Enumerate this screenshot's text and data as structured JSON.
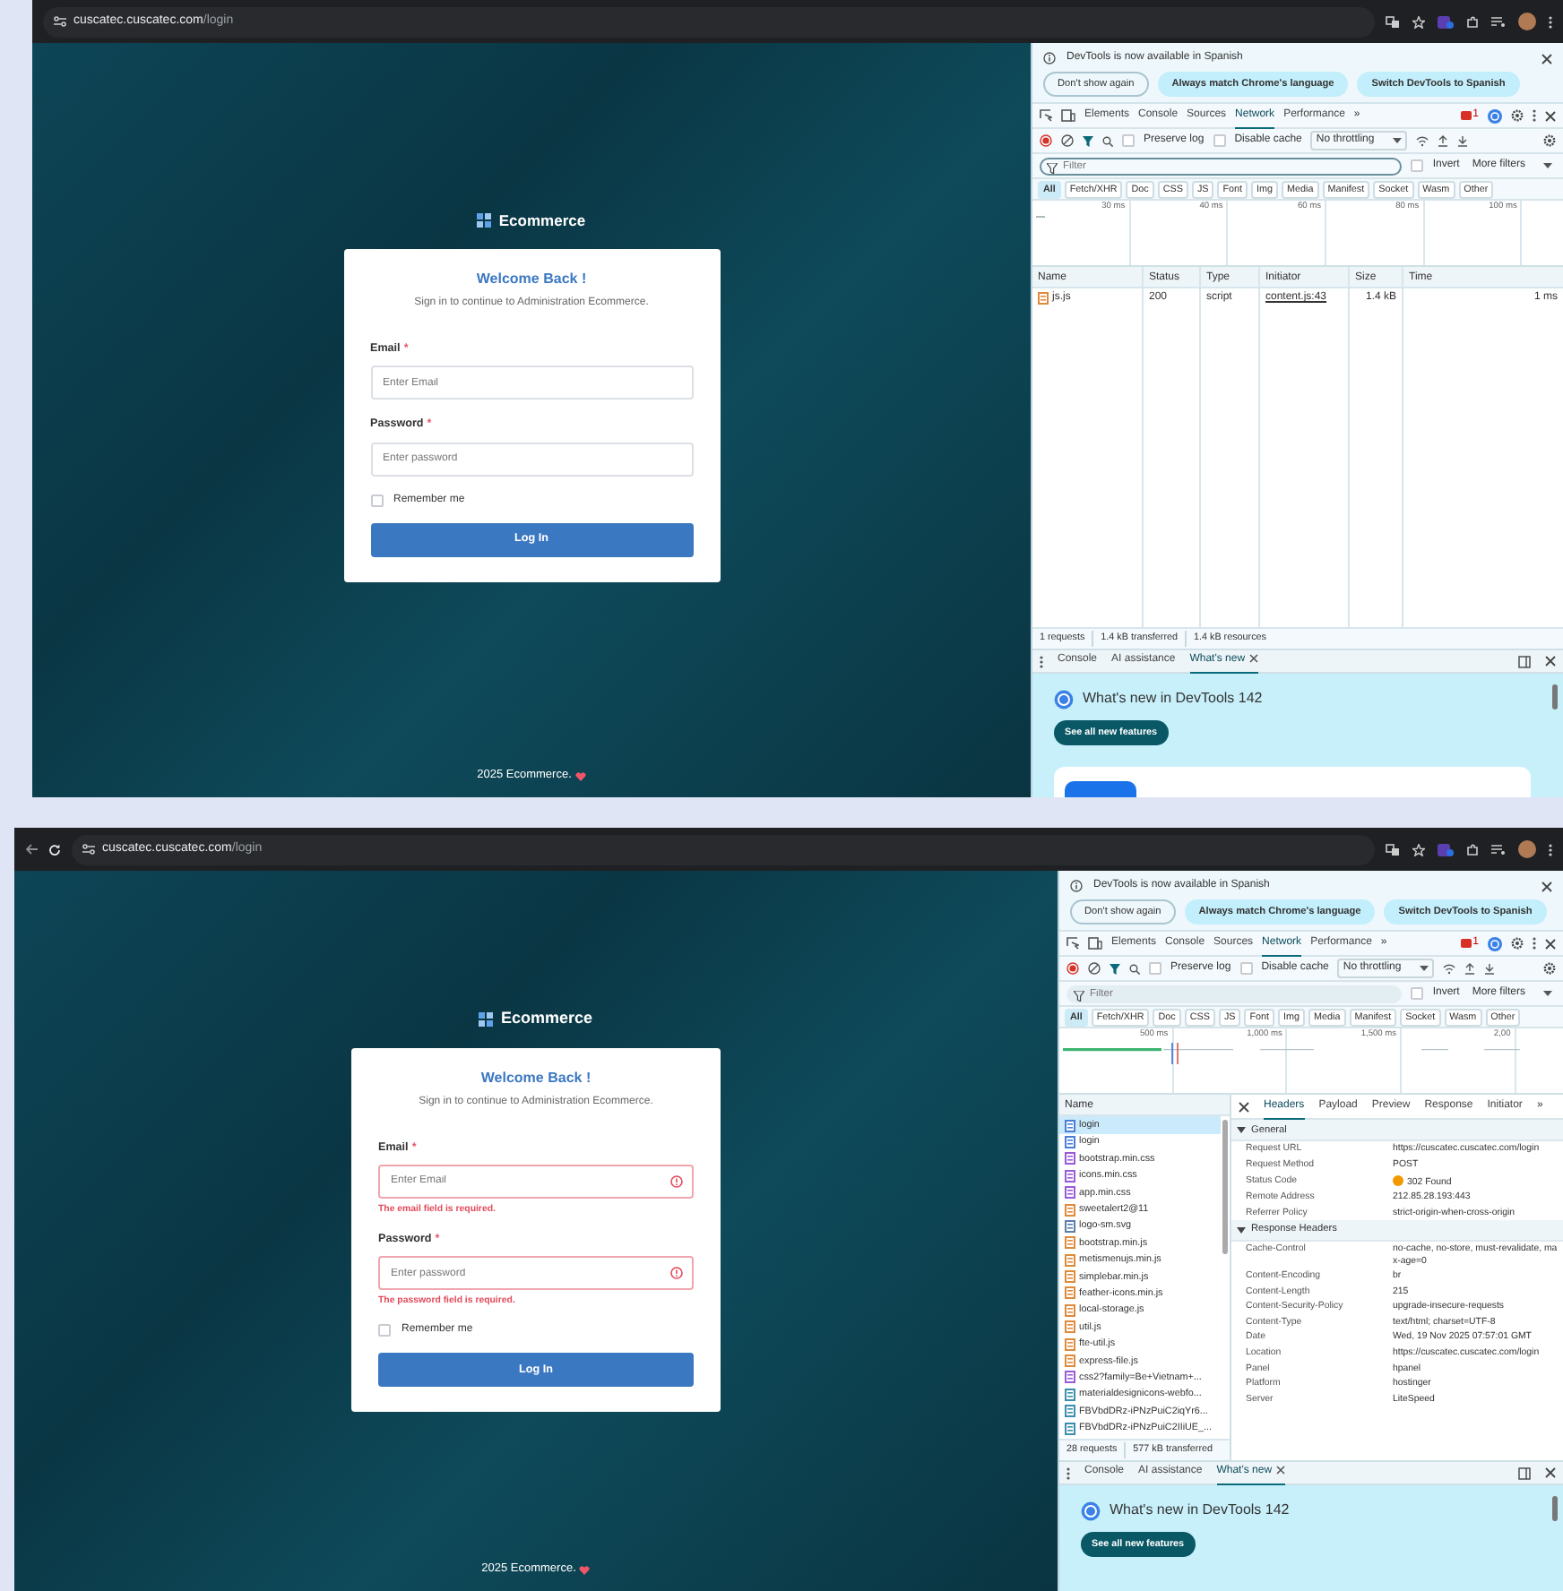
{
  "screens": [
    {
      "kind": "list",
      "address_bar": {
        "nav_buttons": false,
        "host": "cuscatec.cuscatec.com",
        "path": "/login"
      },
      "page": {
        "brand": "Ecommerce",
        "title": "Welcome Back !",
        "subtitle": "Sign in to continue to Administration Ecommerce.",
        "fields": [
          {
            "label": "Email",
            "required_mark": "*",
            "placeholder": "Enter Email",
            "invalid": false
          },
          {
            "label": "Password",
            "required_mark": "*",
            "placeholder": "Enter password",
            "invalid": false
          }
        ],
        "remember": {
          "label": "Remember me",
          "checked": false
        },
        "button": "Log In",
        "footer": "2025 Ecommerce."
      },
      "devtools": {
        "infobar": {
          "message": "DevTools is now available in Spanish",
          "buttons": [
            {
              "label": "Don't show again",
              "kind": "outline"
            },
            {
              "label": "Always match Chrome's language",
              "kind": "filled"
            },
            {
              "label": "Switch DevTools to Spanish",
              "kind": "filled"
            }
          ]
        },
        "tabs": [
          {
            "label": "Elements",
            "selected": false
          },
          {
            "label": "Console",
            "selected": false
          },
          {
            "label": "Sources",
            "selected": false
          },
          {
            "label": "Network",
            "selected": true
          },
          {
            "label": "Performance",
            "selected": false
          }
        ],
        "more_tabs": "»",
        "error_count": "1",
        "toolbar": {
          "preserve_log": {
            "label": "Preserve log",
            "checked": false
          },
          "disable_cache": {
            "label": "Disable cache",
            "checked": false
          },
          "throttling": "No throttling"
        },
        "filter": {
          "placeholder": "Filter",
          "invert": {
            "label": "Invert",
            "checked": false
          },
          "more_filters": "More filters"
        },
        "type_filters": [
          {
            "label": "All",
            "selected": true
          },
          {
            "label": "Fetch/XHR",
            "selected": false
          },
          {
            "label": "Doc",
            "selected": false
          },
          {
            "label": "CSS",
            "selected": false
          },
          {
            "label": "JS",
            "selected": false
          },
          {
            "label": "Font",
            "selected": false
          },
          {
            "label": "Img",
            "selected": false
          },
          {
            "label": "Media",
            "selected": false
          },
          {
            "label": "Manifest",
            "selected": false
          },
          {
            "label": "Socket",
            "selected": false
          },
          {
            "label": "Wasm",
            "selected": false
          },
          {
            "label": "Other",
            "selected": false
          }
        ],
        "overview_ticks": [
          "30 ms",
          "40 ms",
          "60 ms",
          "80 ms",
          "100 ms"
        ],
        "table": {
          "columns": [
            "Name",
            "Status",
            "Type",
            "Initiator",
            "Size",
            "Time"
          ],
          "rows": [
            {
              "kind": "js",
              "cells": [
                "js.js",
                "200",
                "script",
                "content.js:43",
                "1.4 kB",
                "1 ms"
              ]
            }
          ]
        },
        "summary": [
          "1 requests",
          "1.4 kB transferred",
          "1.4 kB resources"
        ],
        "drawer": {
          "tabs": [
            {
              "label": "Console",
              "selected": false,
              "closable": false
            },
            {
              "label": "AI assistance",
              "selected": false,
              "closable": false
            },
            {
              "label": "What's new",
              "selected": true,
              "closable": true
            }
          ],
          "heading": "What's new in DevTools 142",
          "button": "See all new features",
          "preview": true
        }
      }
    },
    {
      "kind": "details",
      "address_bar": {
        "nav_buttons": true,
        "host": "cuscatec.cuscatec.com",
        "path": "/login"
      },
      "page": {
        "brand": "Ecommerce",
        "title": "Welcome Back !",
        "subtitle": "Sign in to continue to Administration Ecommerce.",
        "fields": [
          {
            "label": "Email",
            "required_mark": "*",
            "placeholder": "Enter Email",
            "invalid": true,
            "error": "The email field is required."
          },
          {
            "label": "Password",
            "required_mark": "*",
            "placeholder": "Enter password",
            "invalid": true,
            "error": "The password field is required."
          }
        ],
        "remember": {
          "label": "Remember me",
          "checked": false
        },
        "button": "Log In",
        "footer": "2025 Ecommerce."
      },
      "devtools": {
        "infobar": {
          "message": "DevTools is now available in Spanish",
          "buttons": [
            {
              "label": "Don't show again",
              "kind": "outline"
            },
            {
              "label": "Always match Chrome's language",
              "kind": "filled"
            },
            {
              "label": "Switch DevTools to Spanish",
              "kind": "filled"
            }
          ]
        },
        "tabs": [
          {
            "label": "Elements",
            "selected": false
          },
          {
            "label": "Console",
            "selected": false
          },
          {
            "label": "Sources",
            "selected": false
          },
          {
            "label": "Network",
            "selected": true
          },
          {
            "label": "Performance",
            "selected": false
          }
        ],
        "more_tabs": "»",
        "error_count": "1",
        "toolbar": {
          "preserve_log": {
            "label": "Preserve log",
            "checked": false
          },
          "disable_cache": {
            "label": "Disable cache",
            "checked": false
          },
          "throttling": "No throttling"
        },
        "filter": {
          "placeholder": "Filter",
          "invert": {
            "label": "Invert",
            "checked": false
          },
          "more_filters": "More filters"
        },
        "type_filters": [
          {
            "label": "All",
            "selected": true
          },
          {
            "label": "Fetch/XHR",
            "selected": false
          },
          {
            "label": "Doc",
            "selected": false
          },
          {
            "label": "CSS",
            "selected": false
          },
          {
            "label": "JS",
            "selected": false
          },
          {
            "label": "Font",
            "selected": false
          },
          {
            "label": "Img",
            "selected": false
          },
          {
            "label": "Media",
            "selected": false
          },
          {
            "label": "Manifest",
            "selected": false
          },
          {
            "label": "Socket",
            "selected": false
          },
          {
            "label": "Wasm",
            "selected": false
          },
          {
            "label": "Other",
            "selected": false
          }
        ],
        "overview_ticks": [
          "500 ms",
          "1,000 ms",
          "1,500 ms",
          "2,00"
        ],
        "requests_header": "Name",
        "requests": [
          {
            "name": "login",
            "kind": "doc",
            "selected": true
          },
          {
            "name": "login",
            "kind": "doc",
            "selected": false
          },
          {
            "name": "bootstrap.min.css",
            "kind": "css",
            "selected": false
          },
          {
            "name": "icons.min.css",
            "kind": "css",
            "selected": false
          },
          {
            "name": "app.min.css",
            "kind": "css",
            "selected": false
          },
          {
            "name": "sweetalert2@11",
            "kind": "js",
            "selected": false
          },
          {
            "name": "logo-sm.svg",
            "kind": "img",
            "selected": false
          },
          {
            "name": "bootstrap.min.js",
            "kind": "js",
            "selected": false
          },
          {
            "name": "metismenujs.min.js",
            "kind": "js",
            "selected": false
          },
          {
            "name": "simplebar.min.js",
            "kind": "js",
            "selected": false
          },
          {
            "name": "feather-icons.min.js",
            "kind": "js",
            "selected": false
          },
          {
            "name": "local-storage.js",
            "kind": "js",
            "selected": false
          },
          {
            "name": "util.js",
            "kind": "js",
            "selected": false
          },
          {
            "name": "fte-util.js",
            "kind": "js",
            "selected": false
          },
          {
            "name": "express-file.js",
            "kind": "js",
            "selected": false
          },
          {
            "name": "css2?family=Be+Vietnam+...",
            "kind": "css",
            "selected": false
          },
          {
            "name": "materialdesignicons-webfo...",
            "kind": "font",
            "selected": false
          },
          {
            "name": "FBVbdDRz-iPNzPuiC2iqYr6...",
            "kind": "font",
            "selected": false
          },
          {
            "name": "FBVbdDRz-iPNzPuiC2IIiUE_...",
            "kind": "font",
            "selected": false
          }
        ],
        "summary": [
          "28 requests",
          "577 kB transferred"
        ],
        "detail_tabs": [
          {
            "label": "Headers",
            "selected": true
          },
          {
            "label": "Payload",
            "selected": false
          },
          {
            "label": "Preview",
            "selected": false
          },
          {
            "label": "Response",
            "selected": false
          },
          {
            "label": "Initiator",
            "selected": false
          }
        ],
        "more_detail_tabs": "»",
        "sections": [
          {
            "title": "General",
            "expanded": true,
            "rows": [
              {
                "name": "Request URL",
                "value": "https://cuscatec.cuscatec.com/login"
              },
              {
                "name": "Request Method",
                "value": "POST"
              },
              {
                "name": "Status Code",
                "value": "302 Found",
                "color": "#f29900"
              },
              {
                "name": "Remote Address",
                "value": "212.85.28.193:443"
              },
              {
                "name": "Referrer Policy",
                "value": "strict-origin-when-cross-origin"
              }
            ]
          },
          {
            "title": "Response Headers",
            "expanded": true,
            "rows": [
              {
                "name": "Cache-Control",
                "value": "no-cache, no-store, must-revalidate, max-age=0"
              },
              {
                "name": "Content-Encoding",
                "value": "br"
              },
              {
                "name": "Content-Length",
                "value": "215"
              },
              {
                "name": "Content-Security-Policy",
                "value": "upgrade-insecure-requests"
              },
              {
                "name": "Content-Type",
                "value": "text/html; charset=UTF-8"
              },
              {
                "name": "Date",
                "value": "Wed, 19 Nov 2025 07:57:01 GMT"
              },
              {
                "name": "Location",
                "value": "https://cuscatec.cuscatec.com/login"
              },
              {
                "name": "Panel",
                "value": "hpanel"
              },
              {
                "name": "Platform",
                "value": "hostinger"
              },
              {
                "name": "Server",
                "value": "LiteSpeed"
              }
            ]
          }
        ],
        "drawer": {
          "tabs": [
            {
              "label": "Console",
              "selected": false,
              "closable": false
            },
            {
              "label": "AI assistance",
              "selected": false,
              "closable": false
            },
            {
              "label": "What's new",
              "selected": true,
              "closable": true
            }
          ],
          "heading": "What's new in DevTools 142",
          "button": "See all new features",
          "preview": false
        }
      }
    }
  ]
}
